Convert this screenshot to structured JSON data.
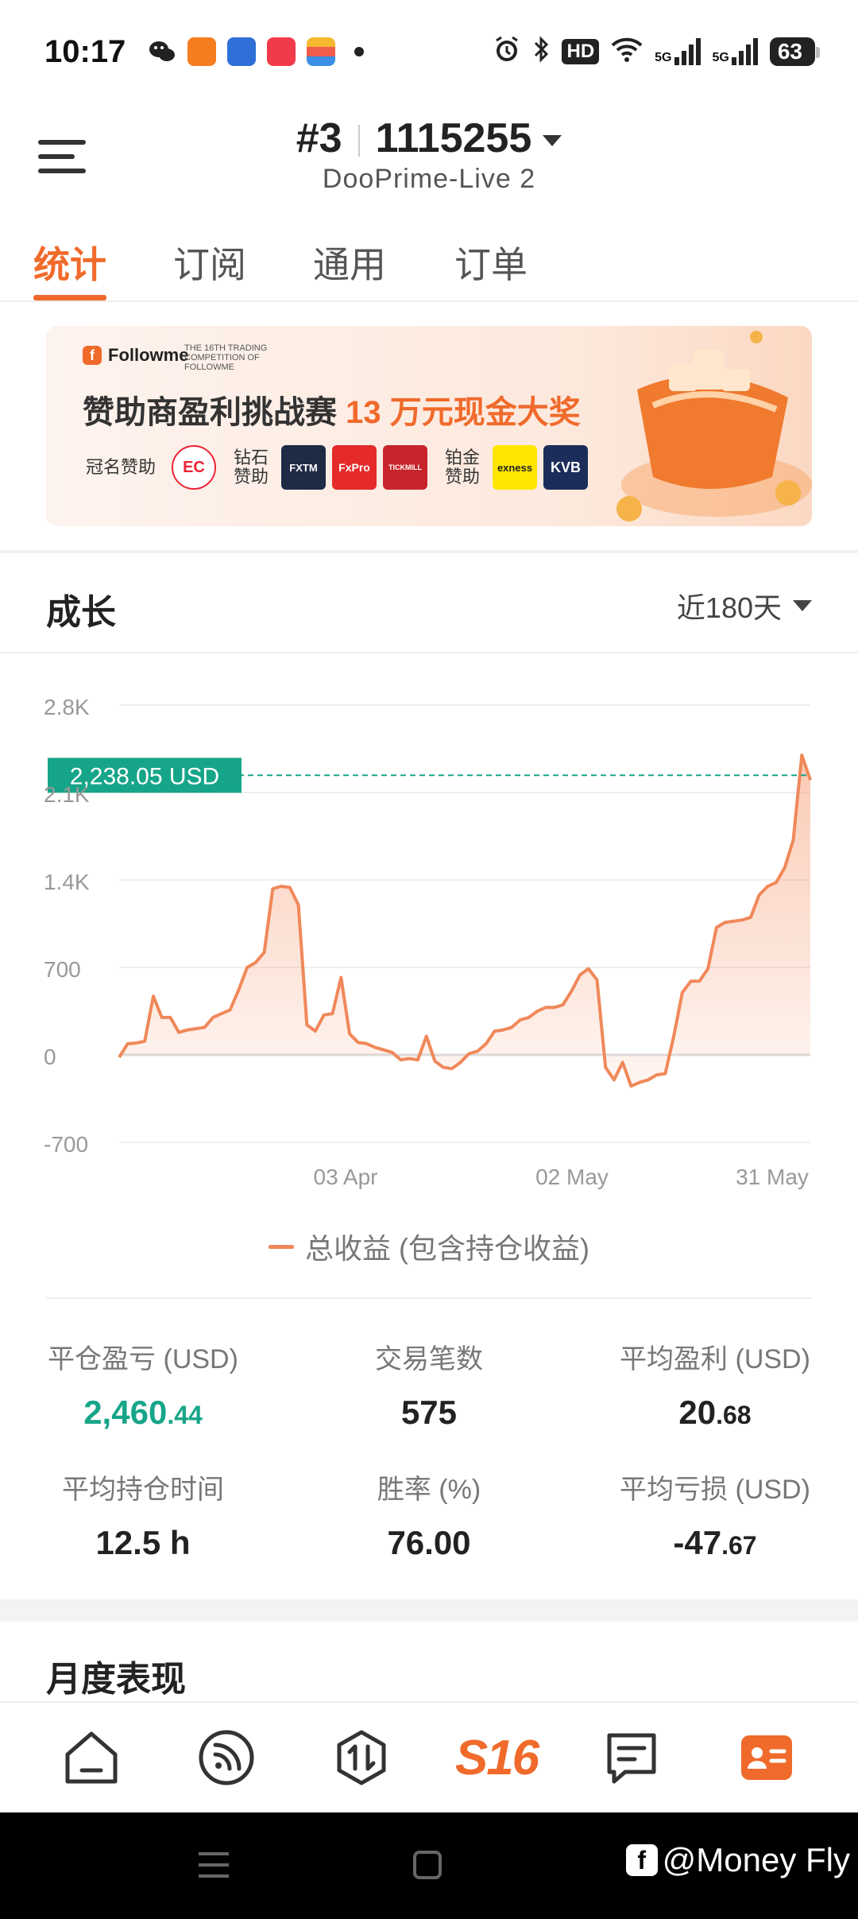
{
  "status_bar": {
    "time": "10:17",
    "hd_label": "HD",
    "net_a": "5G",
    "net_b": "5G",
    "battery": "63"
  },
  "header": {
    "account_num": "#3",
    "account_id": "1115255",
    "server": "DooPrime-Live 2"
  },
  "tabs": [
    {
      "label": "统计",
      "active": true
    },
    {
      "label": "订阅",
      "active": false
    },
    {
      "label": "通用",
      "active": false
    },
    {
      "label": "订单",
      "active": false
    }
  ],
  "banner": {
    "logo_text": "Followme",
    "tag_text": "THE 16TH TRADING COMPETITION OF FOLLOWME",
    "title_prefix": "赞助商盈利挑战赛 ",
    "title_highlight": "13 万元现金大奖",
    "title_sponsor_label": "冠名赞助",
    "diamond_label": "钻石赞助",
    "platinum_label": "铂金赞助",
    "sponsors": {
      "title_sponsor": "EC",
      "diamond": [
        "FXTM",
        "FxPro",
        "TICKMILL"
      ],
      "platinum": [
        "exness",
        "KVB"
      ]
    }
  },
  "growth": {
    "title": "成长",
    "range_label": "近180天",
    "legend_label": "总收益 (包含持仓收益)"
  },
  "chart_data": {
    "type": "area",
    "x_ticks": [
      "03 Apr",
      "02 May",
      "31 May"
    ],
    "y_ticks": [
      "2.8K",
      "2.1K",
      "1.4K",
      "700",
      "0",
      "-700"
    ],
    "ylim": [
      -700,
      2800
    ],
    "current_value_label": "2,238.05 USD",
    "current_value": 2238.05,
    "series": [
      {
        "values": [
          -20,
          90,
          95,
          110,
          470,
          300,
          300,
          180,
          200,
          210,
          220,
          300,
          330,
          360,
          520,
          700,
          740,
          820,
          1330,
          1350,
          1340,
          1200,
          240,
          190,
          320,
          330,
          620,
          170,
          100,
          90,
          60,
          40,
          20,
          -40,
          -30,
          -40,
          150,
          -50,
          -100,
          -110,
          -60,
          10,
          30,
          90,
          190,
          200,
          220,
          280,
          300,
          350,
          380,
          380,
          400,
          510,
          640,
          690,
          600,
          -100,
          -200,
          -60,
          -250,
          -220,
          -200,
          -160,
          -150,
          150,
          500,
          590,
          590,
          690,
          1020,
          1060,
          1070,
          1080,
          1100,
          1280,
          1350,
          1380,
          1500,
          1720,
          2400,
          2200
        ]
      }
    ]
  },
  "stats": [
    {
      "label": "平仓盈亏 (USD)",
      "int": "2,460",
      "dec": ".44",
      "green": true
    },
    {
      "label": "交易笔数",
      "int": "575",
      "dec": "",
      "green": false
    },
    {
      "label": "平均盈利 (USD)",
      "int": "20",
      "dec": ".68",
      "green": false
    },
    {
      "label": "平均持仓时间",
      "int": "12.5 h",
      "dec": "",
      "green": false
    },
    {
      "label": "胜率 (%)",
      "int": "76.00",
      "dec": "",
      "green": false
    },
    {
      "label": "平均亏损 (USD)",
      "int": "-47",
      "dec": ".67",
      "green": false
    }
  ],
  "monthly": {
    "title": "月度表现"
  },
  "bottom_nav": {
    "s16_label": "S16"
  },
  "watermark": {
    "text": "@Money Fly",
    "fb": "f"
  },
  "colors": {
    "accent": "#f06a2b",
    "green": "#17a589",
    "line": "#f0885a"
  }
}
